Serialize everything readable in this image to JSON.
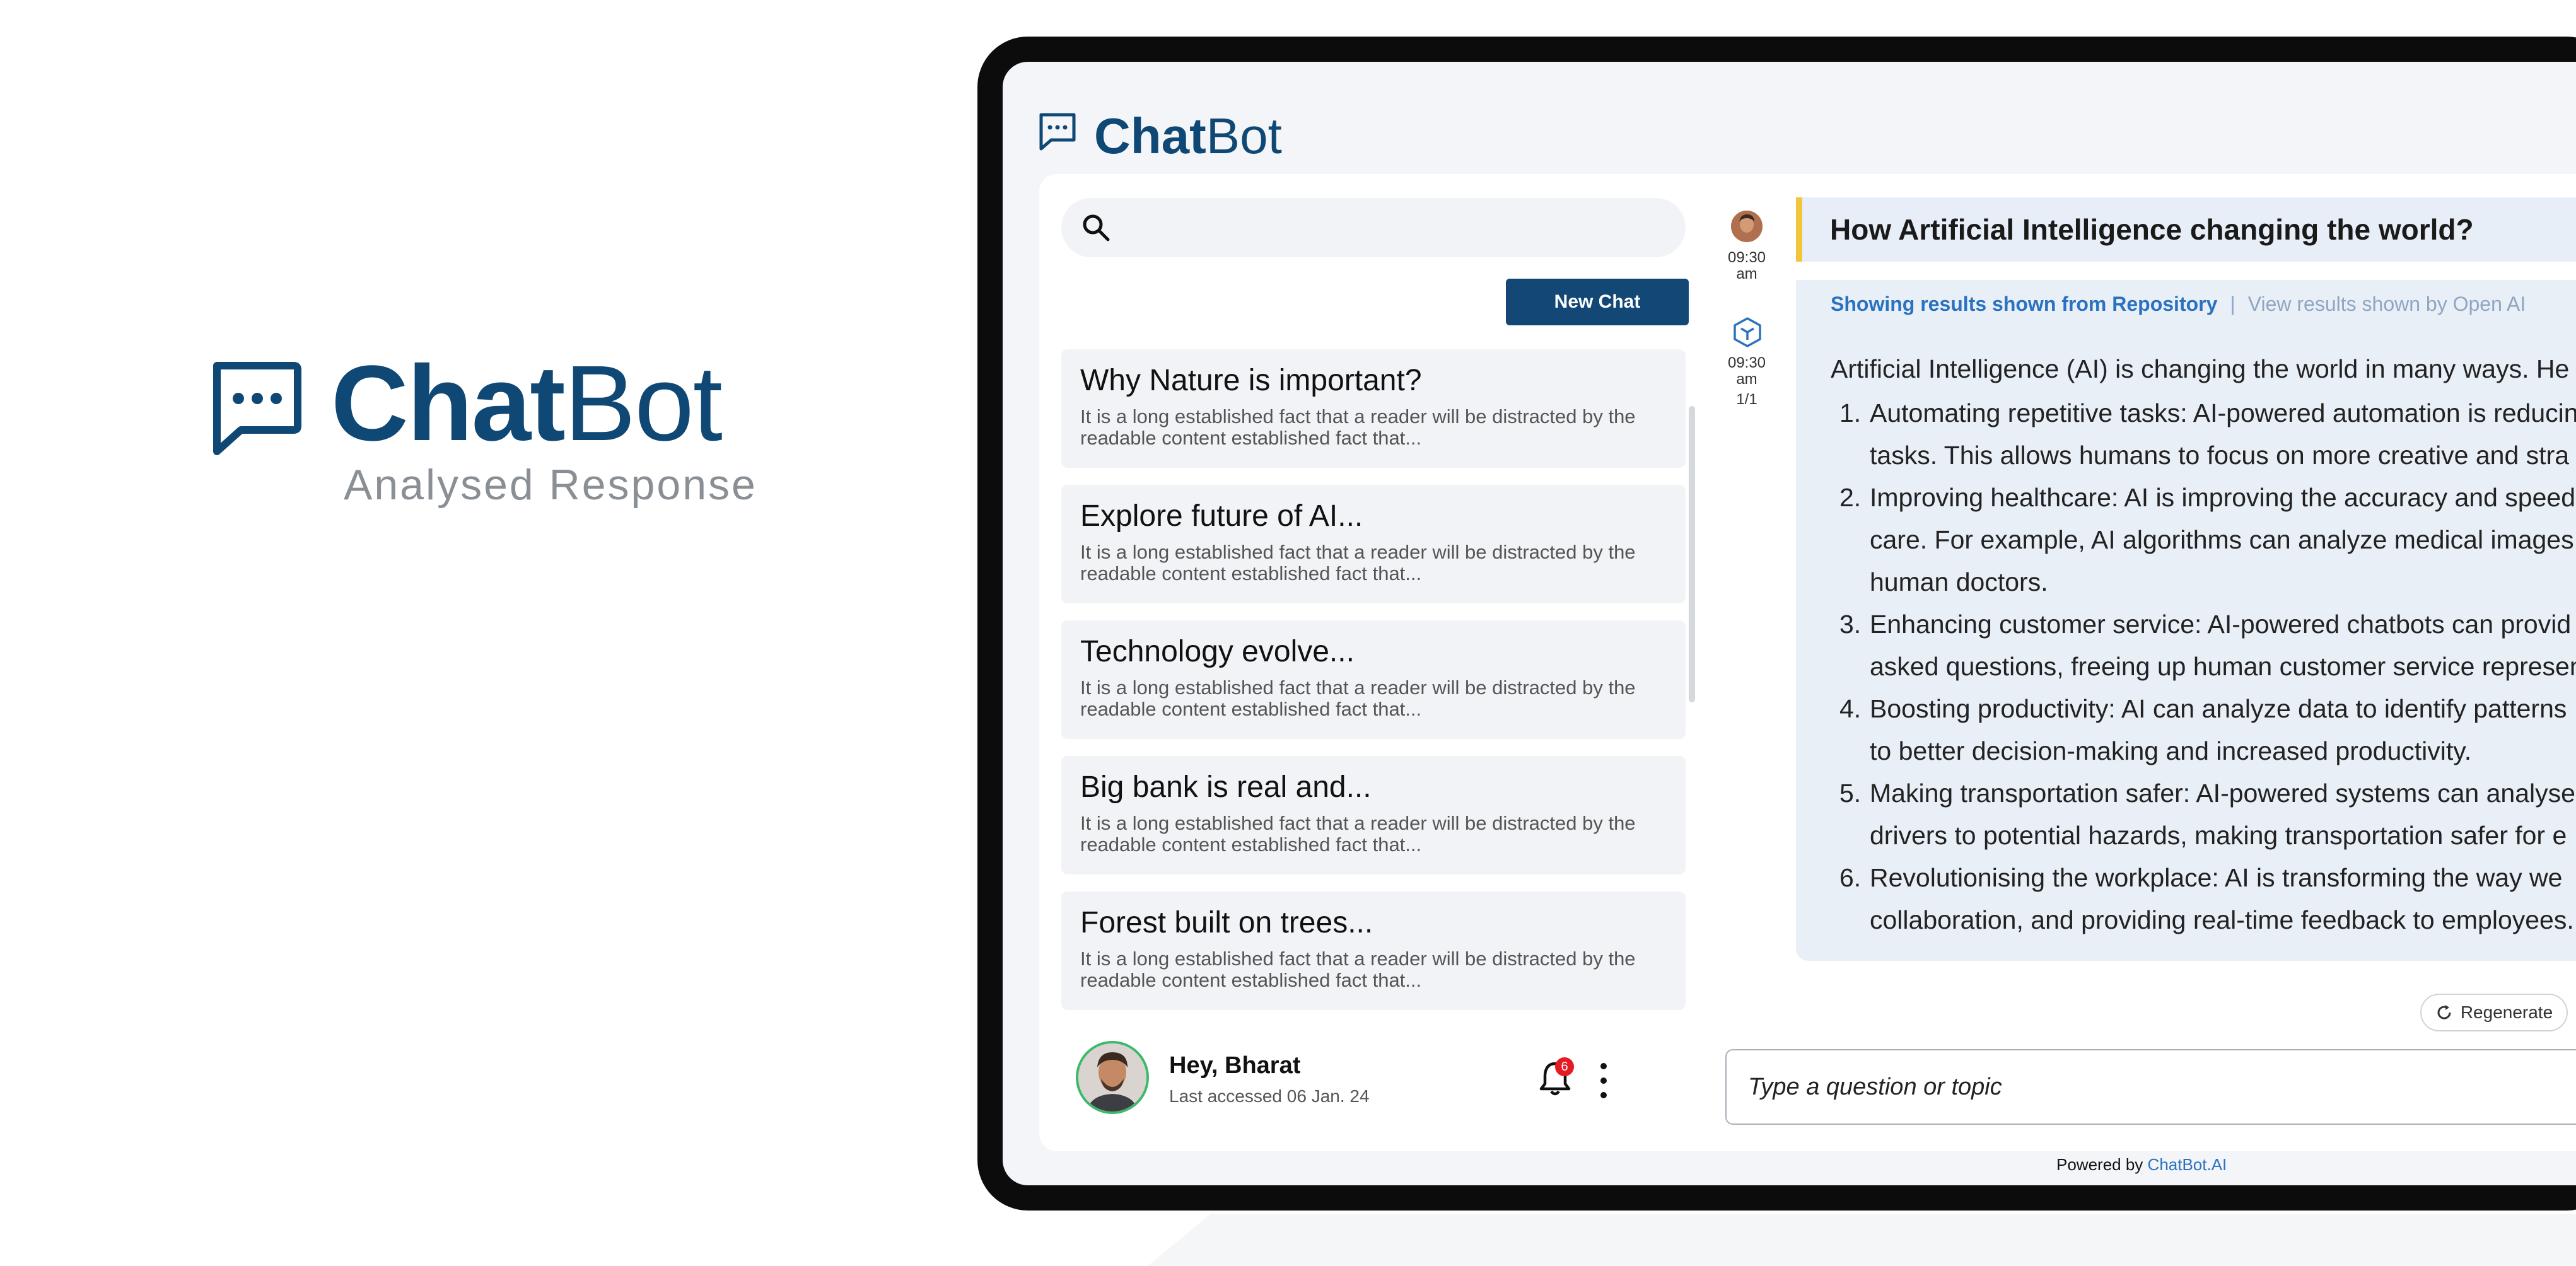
{
  "hero": {
    "title_bold": "Chat",
    "title_light": "Bot",
    "subtitle": "Analysed Response",
    "icon": "chat-bubble-dots-icon"
  },
  "app": {
    "logo_bold": "Chat",
    "logo_light": "Bot",
    "logo_icon": "chat-bubble-dots-icon"
  },
  "sidebar": {
    "search": {
      "placeholder": "",
      "value": "",
      "icon": "search-icon"
    },
    "new_chat_label": "New Chat",
    "chats": [
      {
        "title": "Why Nature is important?",
        "desc": "It is a long established fact that a reader will be distracted by the readable content established fact that..."
      },
      {
        "title": "Explore future of AI...",
        "desc": "It is a long established fact that a reader will be distracted by the readable content established fact that..."
      },
      {
        "title": "Technology evolve...",
        "desc": "It is a long established fact that a reader will be distracted by the readable content established fact that..."
      },
      {
        "title": "Big bank is real and...",
        "desc": "It is a long established fact that a reader will be distracted by the readable content established fact that..."
      },
      {
        "title": "Forest built on trees...",
        "desc": "It is a long established fact that a reader will be distracted by the readable content established fact that..."
      }
    ],
    "user": {
      "greeting": "Hey, Bharat",
      "last_accessed": "Last accessed 06 Jan. 24",
      "notification_count": "6",
      "bell_icon": "bell-icon",
      "menu_icon": "kebab-menu-icon"
    }
  },
  "chat": {
    "question_time": "09:30 am",
    "question": "How Artificial Intelligence changing the world?",
    "answer_time": "09:30 am",
    "answer_page": "1/1",
    "tab_active": "Showing results shown from Repository",
    "tab_separator": "|",
    "tab_inactive": "View results shown by Open AI",
    "intro": "Artificial Intelligence (AI) is changing the world in many ways. He",
    "list_lines": [
      {
        "num": "1.",
        "text": "Automating repetitive tasks: AI-powered automation is reducin"
      },
      {
        "num": "",
        "text": "tasks. This allows humans to focus on more creative and stra"
      },
      {
        "num": "2.",
        "text": "Improving healthcare: AI is improving the accuracy and speed"
      },
      {
        "num": "",
        "text": "care. For example, AI algorithms can analyze medical images"
      },
      {
        "num": "",
        "text": "human doctors."
      },
      {
        "num": "3.",
        "text": "Enhancing customer service: AI-powered chatbots can provid"
      },
      {
        "num": "",
        "text": "asked questions, freeing up human customer service represen"
      },
      {
        "num": "4.",
        "text": "Boosting productivity: AI can analyze data to identify patterns"
      },
      {
        "num": "",
        "text": "to better decision-making and increased productivity."
      },
      {
        "num": "5.",
        "text": "Making transportation safer: AI-powered systems can analyse"
      },
      {
        "num": "",
        "text": "drivers to potential hazards, making transportation safer for e"
      },
      {
        "num": "6.",
        "text": "Revolutionising the workplace: AI is transforming the way we"
      },
      {
        "num": "",
        "text": "collaboration, and providing real-time feedback to employees."
      }
    ],
    "regenerate_label": "Regenerate",
    "input_placeholder": "Type a question or topic",
    "powered_prefix": "Powered by",
    "powered_link": "ChatBot.AI"
  },
  "colors": {
    "brand": "#0f4775",
    "accent_bar": "#f2c53d",
    "link": "#2a72c0",
    "badge": "#e31b23",
    "avatar_ring": "#3cb96a"
  }
}
